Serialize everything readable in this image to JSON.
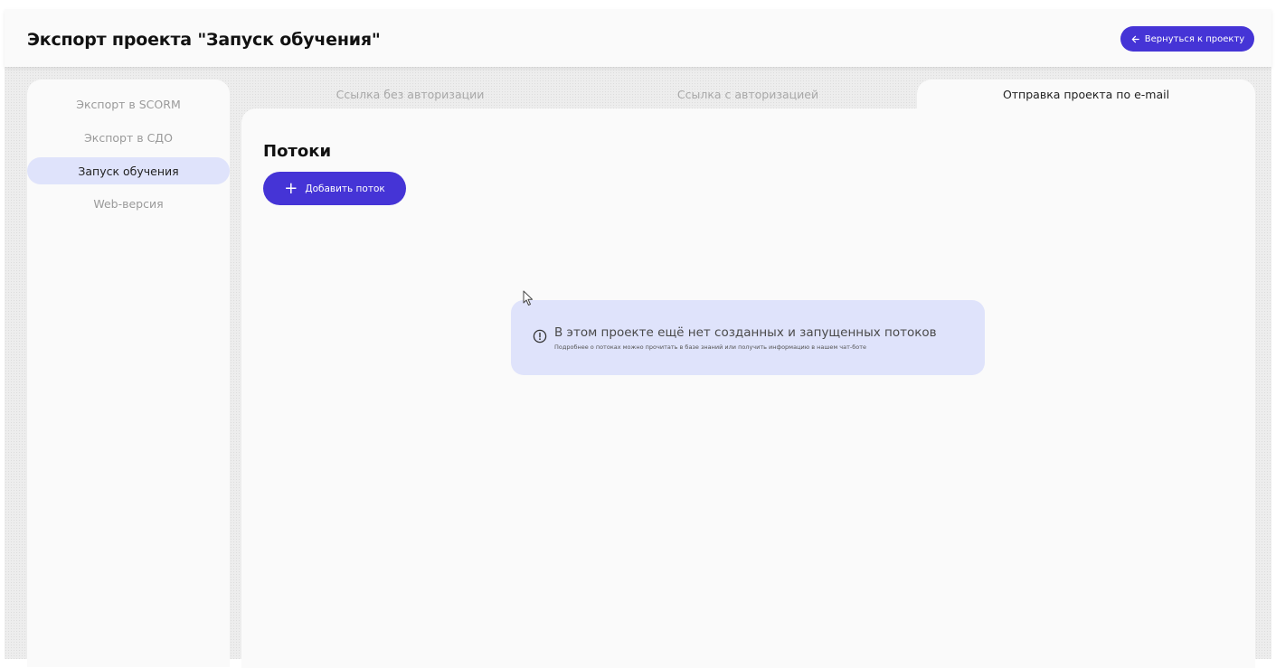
{
  "header": {
    "title": "Экспорт проекта \"Запуск обучения\"",
    "back_label": "Вернуться к проекту"
  },
  "sidebar": {
    "items": [
      {
        "label": "Экспорт в SCORM",
        "active": false
      },
      {
        "label": "Экспорт в СДО",
        "active": false
      },
      {
        "label": "Запуск обучения",
        "active": true
      },
      {
        "label": "Web-версия",
        "active": false
      }
    ]
  },
  "tabs": [
    {
      "label": "Ссылка без авторизации",
      "active": false
    },
    {
      "label": "Ссылка с авторизацией",
      "active": false
    },
    {
      "label": "Отправка проекта по e-mail",
      "active": true
    }
  ],
  "main": {
    "section_title": "Потоки",
    "add_button_label": "Добавить поток",
    "notice": {
      "icon": "info-circle-icon",
      "title": "В этом проекте ещё нет созданных и запущенных потоков",
      "text": "Подробнее о потоках можно прочитать в базе знаний или получить информацию в нашем чат-боте"
    }
  },
  "colors": {
    "accent": "#4534d6",
    "active_bg": "#dfe3fb",
    "panel_bg": "#fafafa"
  }
}
